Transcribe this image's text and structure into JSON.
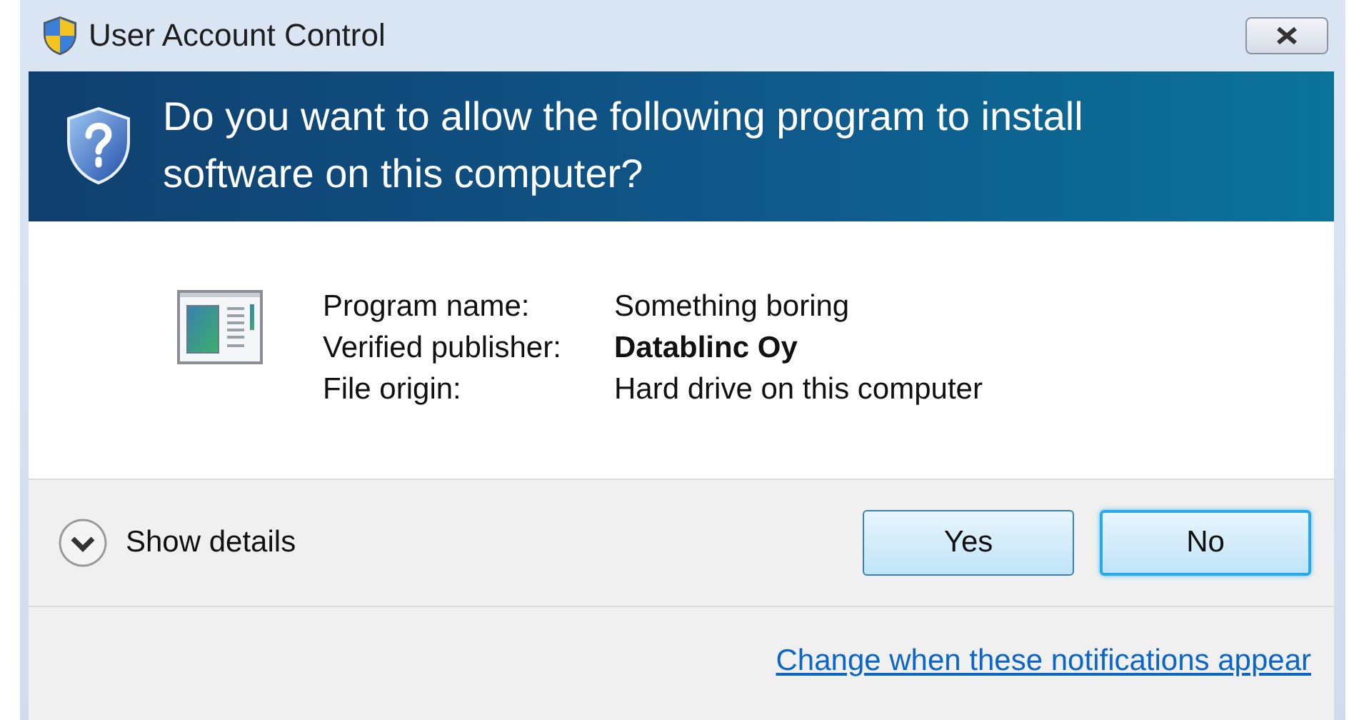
{
  "window": {
    "title": "User Account Control"
  },
  "question": "Do you want to allow the following program to install software on this computer?",
  "details": [
    {
      "label": "Program name:",
      "value": "Something boring",
      "bold": false
    },
    {
      "label": "Verified publisher:",
      "value": "Datablinc Oy",
      "bold": true
    },
    {
      "label": "File origin:",
      "value": "Hard drive on this computer",
      "bold": false
    }
  ],
  "show_details": {
    "label": "Show details",
    "expanded": false
  },
  "buttons": [
    {
      "label": "Yes",
      "focused": false
    },
    {
      "label": "No",
      "focused": true
    }
  ],
  "link": "Change when these notifications appear"
}
